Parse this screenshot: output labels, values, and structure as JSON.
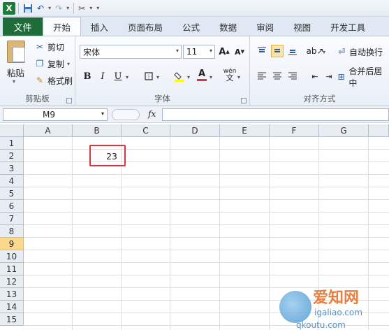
{
  "qat": {
    "app_icon": "X",
    "save_icon": "save-icon",
    "undo_icon": "undo-icon",
    "redo_icon": "redo-icon",
    "customize_icon": "customize-icon"
  },
  "tabs": {
    "file": "文件",
    "items": [
      "开始",
      "插入",
      "页面布局",
      "公式",
      "数据",
      "审阅",
      "视图",
      "开发工具"
    ],
    "active": "开始"
  },
  "clipboard": {
    "paste": "粘贴",
    "cut": "剪切",
    "copy": "复制",
    "format_painter": "格式刷",
    "label": "剪贴板"
  },
  "font": {
    "name": "宋体",
    "size": "11",
    "grow": "A",
    "shrink": "A",
    "bold": "B",
    "italic": "I",
    "underline": "U",
    "font_color": "A",
    "phonetic": "wén",
    "label": "字体"
  },
  "alignment": {
    "wrap_text": "自动换行",
    "merge": "合并后居中",
    "label": "对齐方式"
  },
  "formula_bar": {
    "name_box": "M9",
    "fx": "fx",
    "formula": ""
  },
  "grid": {
    "columns": [
      "A",
      "B",
      "C",
      "D",
      "E",
      "F",
      "G"
    ],
    "rows": [
      "1",
      "2",
      "3",
      "4",
      "5",
      "6",
      "7",
      "8",
      "9",
      "10",
      "11",
      "12",
      "13",
      "14",
      "15"
    ],
    "active_row": "9",
    "cells": [
      {
        "ref": "B2",
        "value": "23"
      }
    ]
  },
  "watermark": {
    "title": "爱知网",
    "url1": "igaliao.com",
    "url2": "qkoutu.com"
  },
  "colors": {
    "file_tab": "#1f6b3a",
    "highlight": "#d9363e",
    "active_row": "#fbd88a"
  }
}
